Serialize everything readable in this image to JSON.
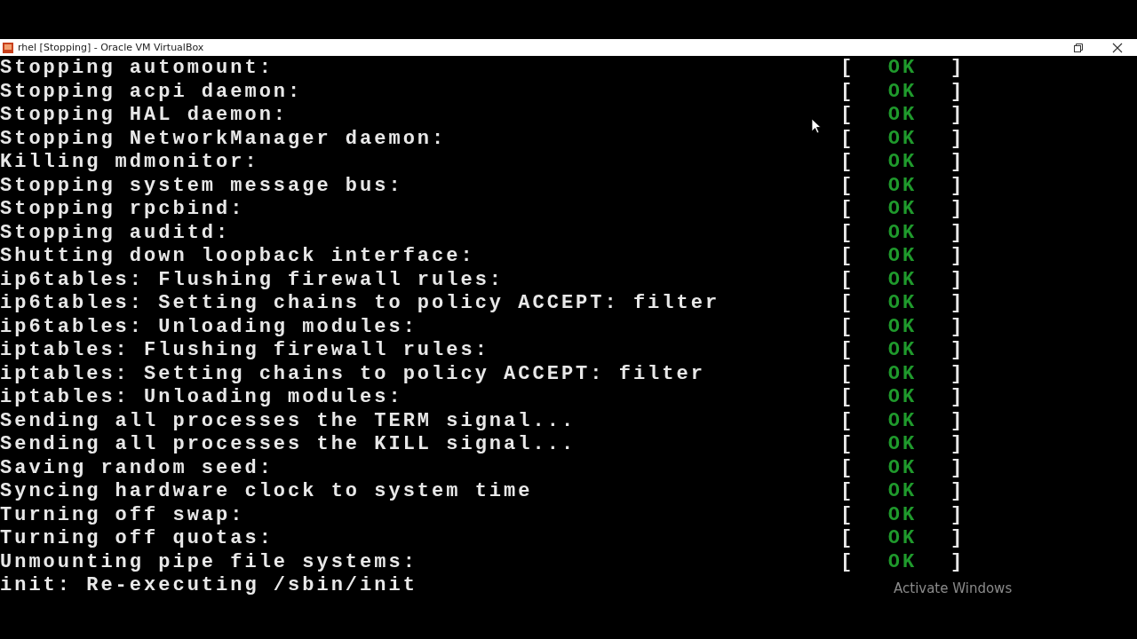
{
  "window": {
    "title": "rhel [Stopping] - Oracle VM VirtualBox"
  },
  "console_lines": [
    {
      "text": "Stopping automount:",
      "open": "[",
      "status": "OK",
      "close": "]"
    },
    {
      "text": "Stopping acpi daemon:",
      "open": "[",
      "status": "OK",
      "close": "]"
    },
    {
      "text": "Stopping HAL daemon:",
      "open": "[",
      "status": "OK",
      "close": "]"
    },
    {
      "text": "Stopping NetworkManager daemon:",
      "open": "[",
      "status": "OK",
      "close": "]"
    },
    {
      "text": "Killing mdmonitor:",
      "open": "[",
      "status": "OK",
      "close": "]"
    },
    {
      "text": "Stopping system message bus:",
      "open": "[",
      "status": "OK",
      "close": "]"
    },
    {
      "text": "Stopping rpcbind:",
      "open": "[",
      "status": "OK",
      "close": "]"
    },
    {
      "text": "Stopping auditd:",
      "open": "[",
      "status": "OK",
      "close": "]"
    },
    {
      "text": "Shutting down loopback interface:",
      "open": "[",
      "status": "OK",
      "close": "]"
    },
    {
      "text": "ip6tables: Flushing firewall rules:",
      "open": "[",
      "status": "OK",
      "close": "]"
    },
    {
      "text": "ip6tables: Setting chains to policy ACCEPT: filter",
      "open": "[",
      "status": "OK",
      "close": "]"
    },
    {
      "text": "ip6tables: Unloading modules:",
      "open": "[",
      "status": "OK",
      "close": "]"
    },
    {
      "text": "iptables: Flushing firewall rules:",
      "open": "[",
      "status": "OK",
      "close": "]"
    },
    {
      "text": "iptables: Setting chains to policy ACCEPT: filter",
      "open": "[",
      "status": "OK",
      "close": "]"
    },
    {
      "text": "iptables: Unloading modules:",
      "open": "[",
      "status": "OK",
      "close": "]"
    },
    {
      "text": "Sending all processes the TERM signal...",
      "open": "[",
      "status": "OK",
      "close": "]"
    },
    {
      "text": "Sending all processes the KILL signal...",
      "open": "[",
      "status": "OK",
      "close": "]"
    },
    {
      "text": "Saving random seed:",
      "open": "[",
      "status": "OK",
      "close": "]"
    },
    {
      "text": "Syncing hardware clock to system time",
      "open": "[",
      "status": "OK",
      "close": "]"
    },
    {
      "text": "Turning off swap:",
      "open": "[",
      "status": "OK",
      "close": "]"
    },
    {
      "text": "Turning off quotas:",
      "open": "[",
      "status": "OK",
      "close": "]"
    },
    {
      "text": "Unmounting pipe file systems:",
      "open": "[",
      "status": "OK",
      "close": "]"
    },
    {
      "text": "init: Re-executing /sbin/init"
    }
  ],
  "activation_notice": "Activate Windows"
}
